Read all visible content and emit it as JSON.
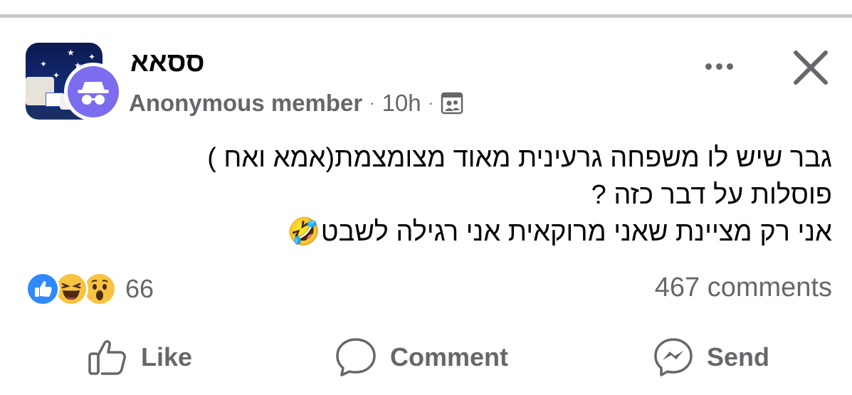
{
  "post": {
    "author": "ססאא",
    "member_label": "Anonymous member",
    "separator": "·",
    "time": "10h",
    "privacy_icon": "members-group-icon",
    "text_lines": [
      "גבר שיש לו משפחה גרעינית מאוד מצומצמת(אמא ואח )",
      "פוסלות על דבר כזה ?",
      "אני רק מציינת שאני מרוקאית אני רגילה לשבט🤣"
    ]
  },
  "header": {
    "more_icon": "more-options-icon",
    "close_icon": "close-icon"
  },
  "reactions": {
    "icons": [
      "like-reaction-icon",
      "haha-reaction-icon",
      "wow-reaction-icon"
    ],
    "count": "66",
    "comments": "467 comments"
  },
  "actions": {
    "like": "Like",
    "comment": "Comment",
    "send": "Send"
  },
  "colors": {
    "secondary_text": "#65676b",
    "like_blue": "#2e89ff",
    "emoji_yellow": "#f7c340",
    "anon_purple": "#7b6cf0"
  }
}
